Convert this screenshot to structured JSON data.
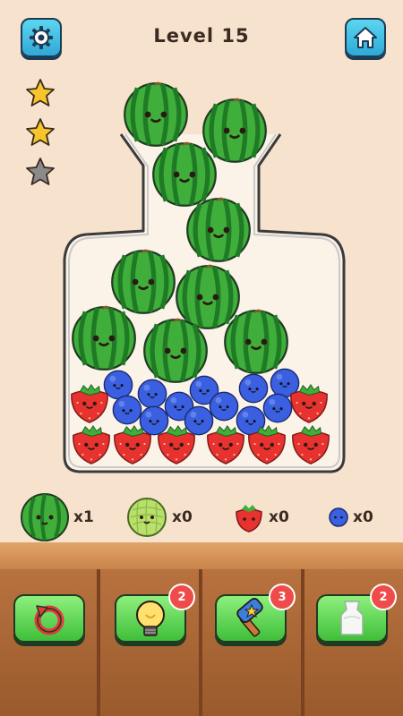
{
  "header": {
    "level_label": "Level 15",
    "settings_icon": "gear-icon",
    "home_icon": "home-icon"
  },
  "stars": {
    "earned": 2,
    "total": 3
  },
  "colors": {
    "background": "#f7e3cd",
    "button_blue": "#2fa9d6",
    "button_green": "#3fbf3a",
    "badge_red": "#ef4b4b",
    "watermelon": "#3fae3a",
    "strawberry": "#e8322f",
    "blueberry": "#3a5fe0"
  },
  "counters": [
    {
      "fruit": "watermelon",
      "count": "x1"
    },
    {
      "fruit": "melon",
      "count": "x0"
    },
    {
      "fruit": "strawberry",
      "count": "x0"
    },
    {
      "fruit": "blueberry",
      "count": "x0"
    }
  ],
  "tools": [
    {
      "name": "undo",
      "icon": "undo-icon",
      "badge": ""
    },
    {
      "name": "hint",
      "icon": "lightbulb-icon",
      "badge": "2"
    },
    {
      "name": "hammer",
      "icon": "hammer-icon",
      "badge": "3"
    },
    {
      "name": "shake",
      "icon": "jar-icon",
      "badge": "2"
    }
  ]
}
